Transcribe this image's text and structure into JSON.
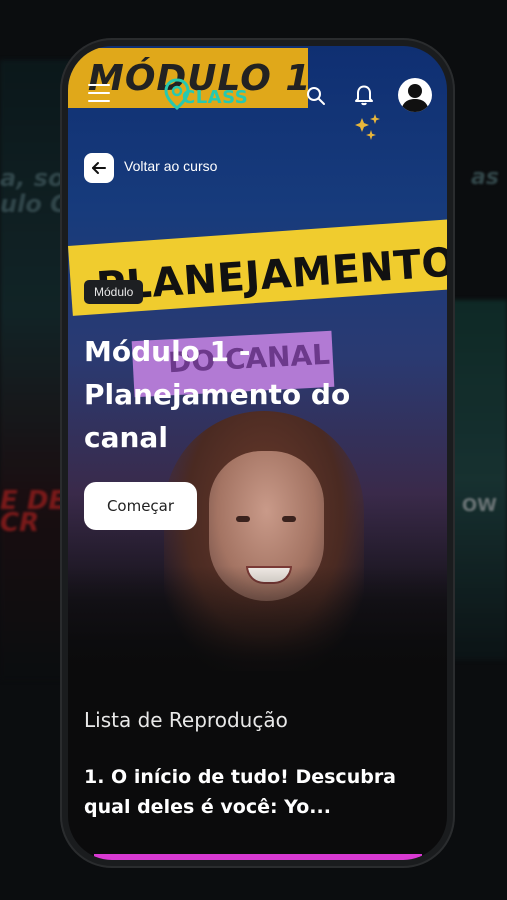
{
  "background": {
    "left_text": "a, sou\nulo Ge",
    "left_red_text": "E DE\nCR",
    "right_text": "as",
    "right_text2": "OW"
  },
  "header": {
    "logo_text": "CLASS",
    "banner_text": "MÓDULO 1"
  },
  "hero_art": {
    "yellow_banner_text": "PLANEJAMENTO",
    "purple_banner_text": "DO CANAL"
  },
  "nav": {
    "back_label": "Voltar ao curso"
  },
  "module": {
    "tag": "Módulo",
    "title": "Módulo 1 - Planejamento do canal",
    "start_label": "Começar"
  },
  "playlist": {
    "heading": "Lista de Reprodução",
    "items": [
      {
        "title": "1. O início de tudo! Descubra qual deles é você: Yo..."
      }
    ]
  },
  "colors": {
    "logo_accent": "#27c9b0",
    "sparkle": "#e8b63a",
    "banner_yellow": "#f0cc2e",
    "banner_purple": "#b27ad4",
    "strip_pink": "#d93ad3"
  },
  "icons": [
    "menu-icon",
    "search-icon",
    "bell-icon",
    "sparkle-icon",
    "avatar-icon",
    "arrow-left-icon"
  ]
}
